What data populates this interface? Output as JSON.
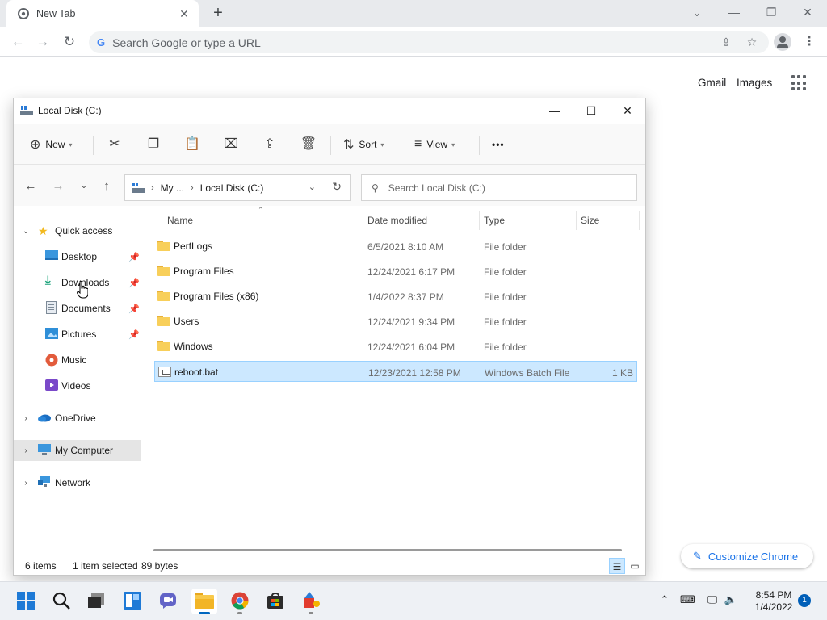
{
  "browser": {
    "tab_title": "New Tab",
    "omnibox_placeholder": "Search Google or type a URL",
    "gmail_label": "Gmail",
    "images_label": "Images",
    "customize_label": "Customize Chrome"
  },
  "explorer": {
    "title": "Local Disk (C:)",
    "commands": {
      "new_label": "New",
      "sort_label": "Sort",
      "view_label": "View",
      "more_label": "•••"
    },
    "address": {
      "crumbs": [
        "My ...",
        "Local Disk (C:)"
      ]
    },
    "search_placeholder": "Search Local Disk (C:)",
    "nav": {
      "quick_access": "Quick access",
      "desktop": "Desktop",
      "downloads": "Downloads",
      "documents": "Documents",
      "pictures": "Pictures",
      "music": "Music",
      "videos": "Videos",
      "onedrive": "OneDrive",
      "my_computer": "My Computer",
      "network": "Network"
    },
    "columns": {
      "name": "Name",
      "date": "Date modified",
      "type": "Type",
      "size": "Size"
    },
    "files": [
      {
        "name": "PerfLogs",
        "date": "6/5/2021 8:10 AM",
        "type": "File folder",
        "size": "",
        "icon": "folder-icon"
      },
      {
        "name": "Program Files",
        "date": "12/24/2021 6:17 PM",
        "type": "File folder",
        "size": "",
        "icon": "folder-icon"
      },
      {
        "name": "Program Files (x86)",
        "date": "1/4/2022 8:37 PM",
        "type": "File folder",
        "size": "",
        "icon": "folder-icon"
      },
      {
        "name": "Users",
        "date": "12/24/2021 9:34 PM",
        "type": "File folder",
        "size": "",
        "icon": "folder-icon"
      },
      {
        "name": "Windows",
        "date": "12/24/2021 6:04 PM",
        "type": "File folder",
        "size": "",
        "icon": "folder-icon"
      },
      {
        "name": "reboot.bat",
        "date": "12/23/2021 12:58 PM",
        "type": "Windows Batch File",
        "size": "1 KB",
        "icon": "batch-file-icon",
        "selected": true
      }
    ],
    "status": {
      "item_count": "6 items",
      "selection": "1 item selected",
      "selection_size": "89 bytes"
    }
  },
  "taskbar": {
    "clock_time": "8:54 PM",
    "clock_date": "1/4/2022",
    "notification_count": "1"
  },
  "colors": {
    "selection_bg": "#cce8ff",
    "selection_border": "#99d1ff",
    "accent": "#0067c0",
    "chrome_link": "#1a73e8"
  }
}
